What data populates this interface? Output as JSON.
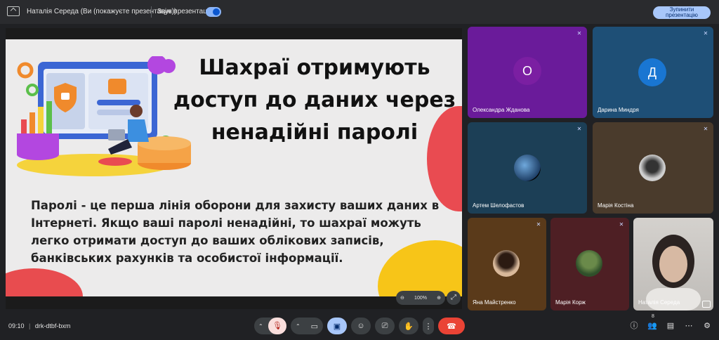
{
  "topbar": {
    "presenter_text": "Наталія Середа (Ви (покажуєте презентацію))",
    "sound_label": "Звук презентації",
    "stop_button": [
      "Зупинити",
      "презентацію"
    ]
  },
  "slide": {
    "title": [
      "Шахраї отримують",
      "доступ до даних через",
      "ненадійні паролі"
    ],
    "body": [
      "Паролі - це перша лінія оборони для захисту ваших даних в",
      "Інтернеті. Якщо ваші паролі ненадійні, то шахраї можуть",
      "легко отримати доступ до ваших облікових записів,",
      "банківських рахунків та особистої інформації."
    ],
    "zoom": "100%"
  },
  "participants": [
    {
      "name": "Олександра Жданова",
      "initial": "О",
      "bg": "#6a1b9a",
      "avatar_bg": "#7b1fa2"
    },
    {
      "name": "Дарина Миндря",
      "initial": "Д",
      "bg": "#1e4f76",
      "avatar_bg": "#1976d2"
    },
    {
      "name": "Артем Шелофастов",
      "initial": "",
      "bg": "#1c3f56"
    },
    {
      "name": "Марія Костіна",
      "initial": "",
      "bg": "#4a3b2c"
    },
    {
      "name": "Яна Майстренко",
      "initial": "",
      "bg": "#5a3a1a"
    },
    {
      "name": "Марія Корж",
      "initial": "",
      "bg": "#4e1f24"
    },
    {
      "name": "Наталія Середа",
      "initial": "",
      "bg": "#c8c6c4"
    }
  ],
  "bottombar": {
    "time": "09:10",
    "separator": "|",
    "meeting_code": "drk-dtbf-bxm",
    "people_count": "8"
  },
  "colors": {
    "end_call": "#ea4335",
    "mic_off_bg": "#f9dedc",
    "present_active": "#a8c7fa"
  }
}
